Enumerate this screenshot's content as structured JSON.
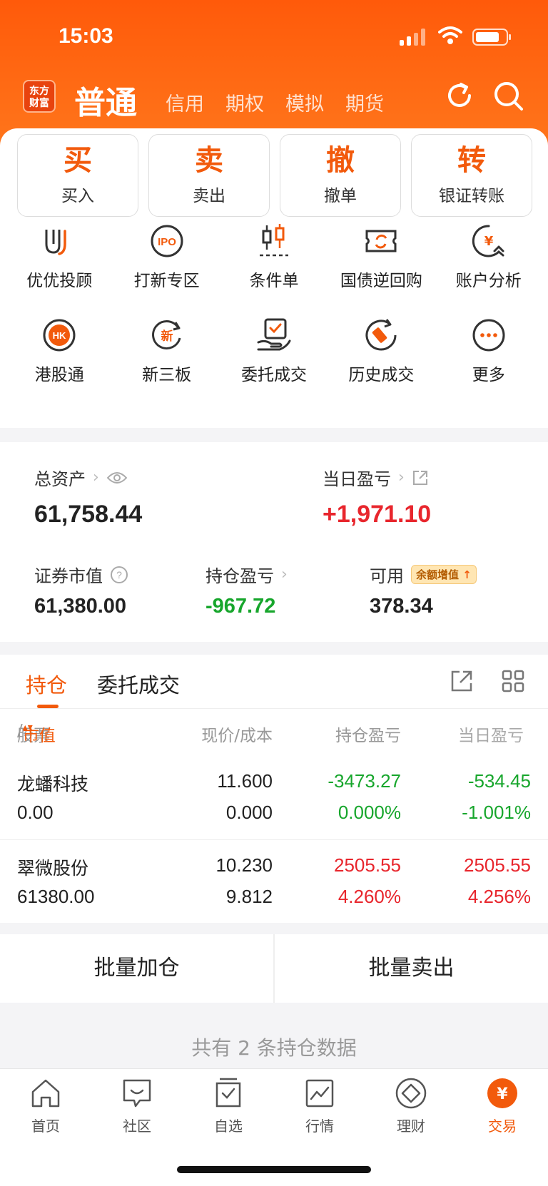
{
  "status": {
    "time": "15:03"
  },
  "header": {
    "logo_line1": "东方",
    "logo_line2": "财富",
    "account_active": "普通",
    "account_tabs": [
      "信用",
      "期权",
      "模拟",
      "期货"
    ],
    "icons": [
      "refresh-icon",
      "search-icon"
    ]
  },
  "quick_actions": [
    {
      "big": "买",
      "label": "买入"
    },
    {
      "big": "卖",
      "label": "卖出"
    },
    {
      "big": "撤",
      "label": "撤单"
    },
    {
      "big": "转",
      "label": "银证转账"
    }
  ],
  "grid_row1": [
    {
      "label": "优优投顾",
      "icon": "advisor-icon"
    },
    {
      "label": "打新专区",
      "icon": "ipo-icon",
      "icon_text": "IPO"
    },
    {
      "label": "条件单",
      "icon": "candlestick-icon"
    },
    {
      "label": "国债逆回购",
      "icon": "ticket-icon"
    },
    {
      "label": "账户分析",
      "icon": "yuan-chat-icon",
      "icon_text": "¥"
    }
  ],
  "grid_row2": [
    {
      "label": "港股通",
      "icon": "hk-icon",
      "icon_text": "HK"
    },
    {
      "label": "新三板",
      "icon": "new-board-icon",
      "icon_text": "新"
    },
    {
      "label": "委托成交",
      "icon": "order-hand-icon"
    },
    {
      "label": "历史成交",
      "icon": "history-icon"
    },
    {
      "label": "更多",
      "icon": "more-icon"
    }
  ],
  "assets": {
    "total_label": "总资产",
    "total_value": "61,758.44",
    "daily_pl_label": "当日盈亏",
    "daily_pl_value": "+1,971.10",
    "market_value_label": "证券市值",
    "market_value": "61,380.00",
    "position_pl_label": "持仓盈亏",
    "position_pl_value": "-967.72",
    "available_label": "可用",
    "available_badge": "余额增值",
    "available_value": "378.34"
  },
  "holdings": {
    "tabs": [
      "持仓",
      "委托成交"
    ],
    "columns": {
      "stock": "股票",
      "market_value": "市值",
      "price_cost": "现价/成本",
      "position_pl": "持仓盈亏",
      "daily_pl": "当日盈亏"
    },
    "rows": [
      {
        "name": "龙蟠科技",
        "mv": "0.00",
        "price": "11.600",
        "cost": "0.000",
        "pl": "-3473.27",
        "pl_pct": "0.000%",
        "dpl": "-534.45",
        "dpl_pct": "-1.001%"
      },
      {
        "name": "翠微股份",
        "mv": "61380.00",
        "price": "10.230",
        "cost": "9.812",
        "pl": "2505.55",
        "pl_pct": "4.260%",
        "dpl": "2505.55",
        "dpl_pct": "4.256%"
      }
    ]
  },
  "batch": {
    "add": "批量加仓",
    "sell": "批量卖出"
  },
  "count_text": "共有 2 条持仓数据",
  "nav": [
    {
      "label": "首页",
      "icon": "home-icon"
    },
    {
      "label": "社区",
      "icon": "community-icon"
    },
    {
      "label": "自选",
      "icon": "watchlist-icon"
    },
    {
      "label": "行情",
      "icon": "market-icon"
    },
    {
      "label": "理财",
      "icon": "wealth-icon"
    },
    {
      "label": "交易",
      "icon": "trade-icon",
      "icon_text": "¥"
    }
  ],
  "colors": {
    "accent": "#f25a0c",
    "up": "#e8262d",
    "down": "#17a62c"
  }
}
